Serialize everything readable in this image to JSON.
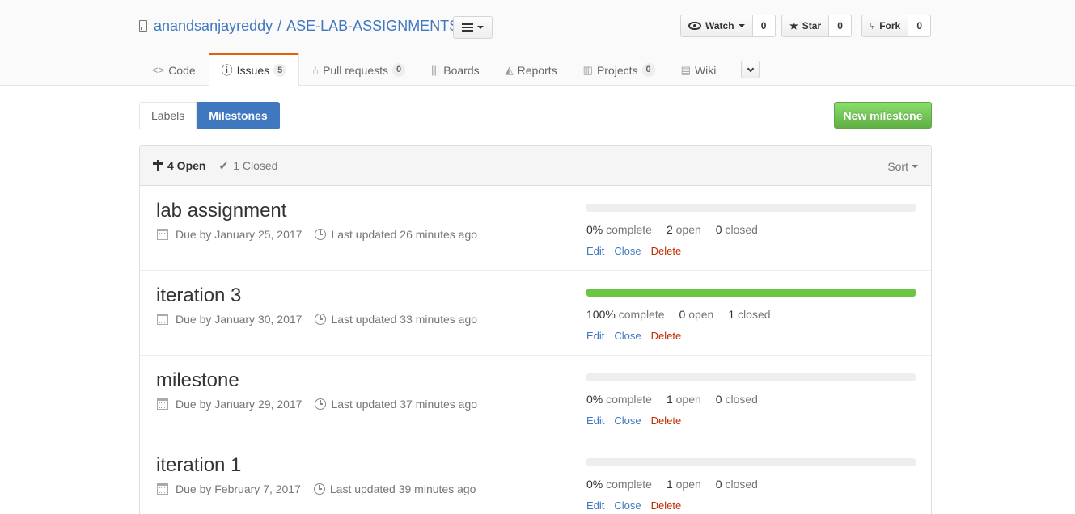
{
  "repo": {
    "owner": "anandsanjayreddy",
    "separator": "/",
    "name": "ASE-LAB-ASSIGNMENTS"
  },
  "social": {
    "watch_label": "Watch",
    "watch_count": "0",
    "star_label": "Star",
    "star_count": "0",
    "fork_label": "Fork",
    "fork_count": "0"
  },
  "nav": {
    "code": "Code",
    "issues": "Issues",
    "issues_count": "5",
    "pulls": "Pull requests",
    "pulls_count": "0",
    "boards": "Boards",
    "reports": "Reports",
    "projects": "Projects",
    "projects_count": "0",
    "wiki": "Wiki"
  },
  "subnav": {
    "labels": "Labels",
    "milestones": "Milestones"
  },
  "new_milestone_label": "New milestone",
  "filters": {
    "open": "4 Open",
    "closed": "1 Closed",
    "sort": "Sort"
  },
  "milestones": [
    {
      "title": "lab assignment",
      "due": "Due by January 25, 2017",
      "updated": "Last updated 26 minutes ago",
      "progress": 0,
      "percent": "0%",
      "complete_label": "complete",
      "open": "2",
      "open_label": "open",
      "closed": "0",
      "closed_label": "closed"
    },
    {
      "title": "iteration 3",
      "due": "Due by January 30, 2017",
      "updated": "Last updated 33 minutes ago",
      "progress": 100,
      "percent": "100%",
      "complete_label": "complete",
      "open": "0",
      "open_label": "open",
      "closed": "1",
      "closed_label": "closed"
    },
    {
      "title": "milestone",
      "due": "Due by January 29, 2017",
      "updated": "Last updated 37 minutes ago",
      "progress": 0,
      "percent": "0%",
      "complete_label": "complete",
      "open": "1",
      "open_label": "open",
      "closed": "0",
      "closed_label": "closed"
    },
    {
      "title": "iteration 1",
      "due": "Due by February 7, 2017",
      "updated": "Last updated 39 minutes ago",
      "progress": 0,
      "percent": "0%",
      "complete_label": "complete",
      "open": "1",
      "open_label": "open",
      "closed": "0",
      "closed_label": "closed"
    }
  ],
  "actions": {
    "edit": "Edit",
    "close": "Close",
    "delete": "Delete"
  },
  "colors": {
    "link": "#4078c0",
    "progress": "#6cc644",
    "danger": "#bd2c00",
    "tab_accent": "#e36209",
    "primary_btn": "#60b044"
  }
}
